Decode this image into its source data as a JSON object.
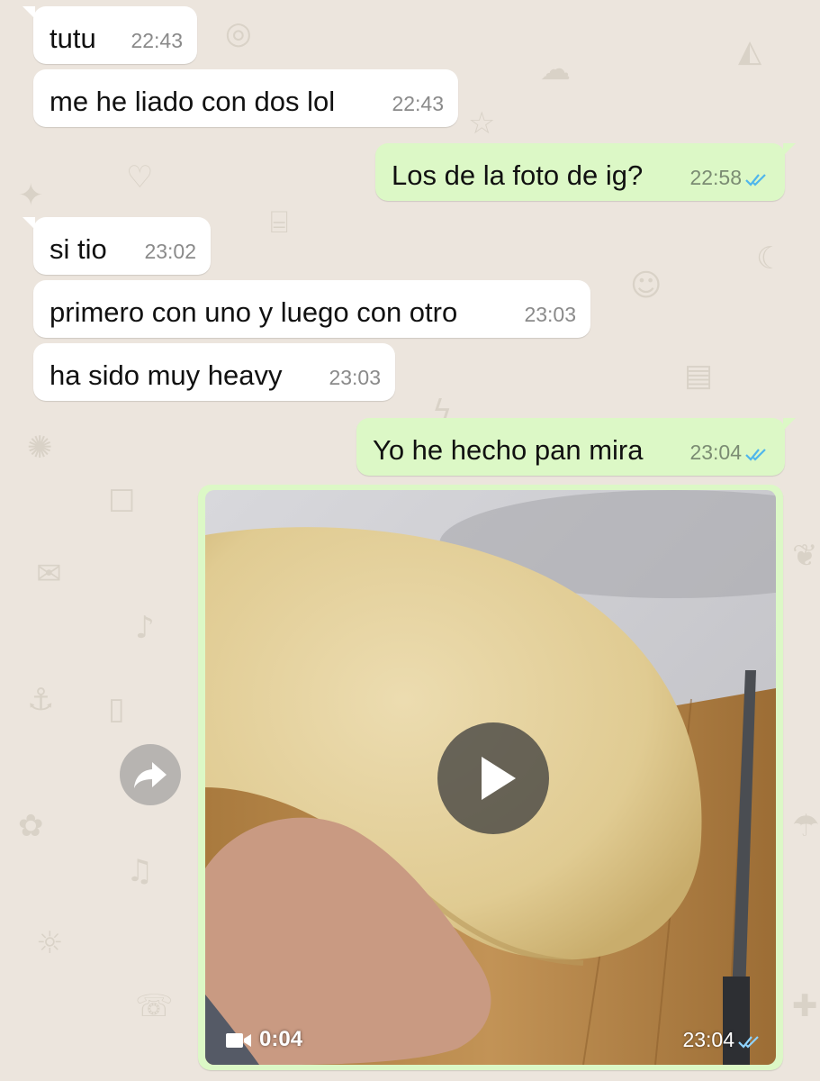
{
  "chat": {
    "messages": [
      {
        "dir": "in",
        "text": "tutu",
        "time": "22:43"
      },
      {
        "dir": "in",
        "text": "me he liado con dos lol",
        "time": "22:43"
      },
      {
        "dir": "out",
        "text": "Los de la foto de ig?",
        "time": "22:58",
        "status": "read"
      },
      {
        "dir": "in",
        "text": "si tio",
        "time": "23:02"
      },
      {
        "dir": "in",
        "text": "primero con uno y luego con otro",
        "time": "23:03"
      },
      {
        "dir": "in",
        "text": "ha sido muy heavy",
        "time": "23:03"
      },
      {
        "dir": "out",
        "text": "Yo he hecho pan mira",
        "time": "23:04",
        "status": "read"
      }
    ],
    "video": {
      "duration": "0:04",
      "time": "23:04",
      "status": "read",
      "icon": "play-icon"
    },
    "forward_icon": "forward-icon"
  },
  "colors": {
    "background": "#ece5dd",
    "incoming_bubble": "#ffffff",
    "outgoing_bubble": "#dcf8c6",
    "read_ticks": "#4fb6ec"
  }
}
